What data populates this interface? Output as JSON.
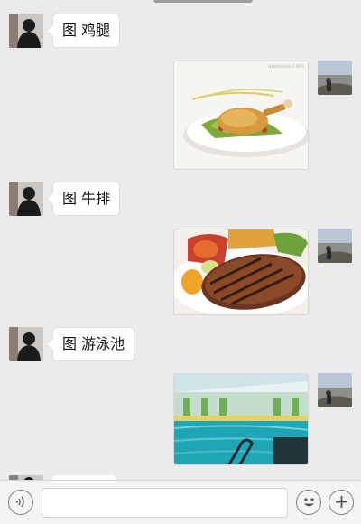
{
  "messages": [
    {
      "side": "left",
      "type": "text",
      "icon": "image-icon",
      "text": "图 鸡腿"
    },
    {
      "side": "right",
      "type": "image",
      "image": "roast-chicken-leg-photo",
      "watermark": "ooooooo.com"
    },
    {
      "side": "left",
      "type": "text",
      "icon": "image-icon",
      "text": "图 牛排"
    },
    {
      "side": "right",
      "type": "image",
      "image": "grilled-steak-photo"
    },
    {
      "side": "left",
      "type": "text",
      "icon": "image-icon",
      "text": "图 游泳池"
    },
    {
      "side": "right",
      "type": "image",
      "image": "swimming-pool-photo"
    }
  ],
  "input_bar": {
    "voice_icon": "voice-icon",
    "emoji_icon": "emoji-icon",
    "plus_icon": "plus-icon",
    "value": ""
  }
}
